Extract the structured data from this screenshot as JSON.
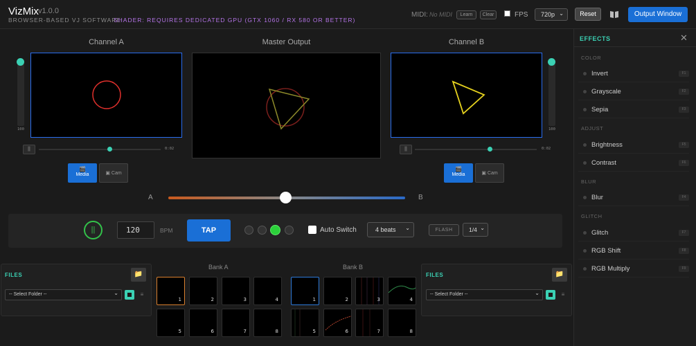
{
  "header": {
    "title": "VizMix",
    "version": "v1.0.0",
    "subtitle": "BROWSER-BASED VJ SOFTWARE",
    "shader_note": "SHADER: REQUIRES DEDICATED GPU (GTX 1060 / RX 580 OR BETTER)",
    "midi_label": "MIDI:",
    "midi_status": "No MIDI",
    "learn_label": "Learn",
    "clear_label": "Clear",
    "fps_label": "FPS",
    "fps_checked": false,
    "resolution": "720p",
    "reset_label": "Reset",
    "output_label": "Output Window",
    "accent": "#1a6fd6"
  },
  "channel_a": {
    "title": "Channel A",
    "opacity": "100",
    "time": "0:02",
    "source_media": "Media",
    "source_cam": "Cam",
    "active_source": "Media",
    "outline_color": "#2a6ef0"
  },
  "master": {
    "title": "Master Output"
  },
  "channel_b": {
    "title": "Channel B",
    "opacity": "100",
    "time": "0:02",
    "source_media": "Media",
    "source_cam": "Cam",
    "active_source": "Media",
    "outline_color": "#2a6ef0"
  },
  "crossfader": {
    "label_a": "A",
    "label_b": "B",
    "position": 0.5
  },
  "controls": {
    "beat_icon": "||",
    "bpm": "120",
    "bpm_label": "BPM",
    "tap_label": "TAP",
    "beat_dots": [
      false,
      false,
      true,
      false
    ],
    "auto_switch_label": "Auto Switch",
    "auto_switch_checked": false,
    "beats_select": "4 beats",
    "flash_label": "FLASH",
    "division": "1/4",
    "beat_color": "#2bd13a"
  },
  "files_a": {
    "title": "FILES",
    "folder_placeholder": "-- Select Folder --"
  },
  "files_b": {
    "title": "FILES",
    "folder_placeholder": "-- Select Folder --"
  },
  "bank_a": {
    "title": "Bank A",
    "slots": [
      "1",
      "2",
      "3",
      "4",
      "5",
      "6",
      "7",
      "8"
    ],
    "selected": "1",
    "selected_color": "#d97f2e"
  },
  "bank_b": {
    "title": "Bank B",
    "slots": [
      "1",
      "2",
      "3",
      "4",
      "5",
      "6",
      "7",
      "8"
    ],
    "selected": "1",
    "selected_color": "#2e7ad9"
  },
  "effects": {
    "title": "EFFECTS",
    "accent": "#3bd1b4",
    "categories": [
      {
        "name": "COLOR",
        "items": [
          {
            "name": "Invert",
            "key": "F1"
          },
          {
            "name": "Grayscale",
            "key": "F2"
          },
          {
            "name": "Sepia",
            "key": "F3"
          }
        ]
      },
      {
        "name": "ADJUST",
        "items": [
          {
            "name": "Brightness",
            "key": "F5"
          },
          {
            "name": "Contrast",
            "key": "F6"
          }
        ]
      },
      {
        "name": "BLUR",
        "items": [
          {
            "name": "Blur",
            "key": "F4"
          }
        ]
      },
      {
        "name": "GLITCH",
        "items": [
          {
            "name": "Glitch",
            "key": "F7"
          },
          {
            "name": "RGB Shift",
            "key": "F8"
          },
          {
            "name": "RGB Multiply",
            "key": "F9"
          }
        ]
      }
    ]
  }
}
